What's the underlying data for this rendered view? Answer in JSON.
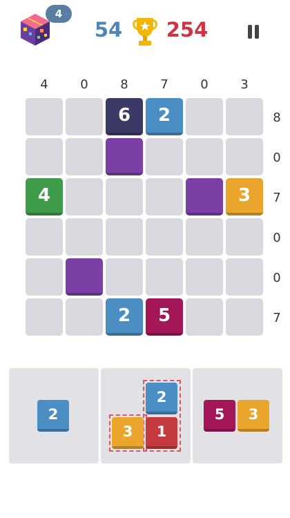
{
  "header": {
    "badge_count": "4",
    "score": "54",
    "best": "254",
    "icons": [
      "gift-box-icon",
      "trophy-icon",
      "pause-icon"
    ]
  },
  "board": {
    "column_sums": [
      "4",
      "0",
      "8",
      "7",
      "0",
      "3"
    ],
    "row_sums": [
      "8",
      "0",
      "7",
      "0",
      "0",
      "7"
    ],
    "tiles": [
      {
        "row": 0,
        "col": 2,
        "value": "6",
        "color": "#3b3a66"
      },
      {
        "row": 0,
        "col": 3,
        "value": "2",
        "color": "#4b8ec4"
      },
      {
        "row": 1,
        "col": 2,
        "value": "",
        "color": "#7c3fa6"
      },
      {
        "row": 2,
        "col": 0,
        "value": "4",
        "color": "#3f9c4b"
      },
      {
        "row": 2,
        "col": 4,
        "value": "",
        "color": "#7c3fa6"
      },
      {
        "row": 2,
        "col": 5,
        "value": "3",
        "color": "#e9a52c"
      },
      {
        "row": 4,
        "col": 1,
        "value": "",
        "color": "#7c3fa6"
      },
      {
        "row": 5,
        "col": 2,
        "value": "2",
        "color": "#4b8ec4"
      },
      {
        "row": 5,
        "col": 3,
        "value": "5",
        "color": "#a31759"
      }
    ]
  },
  "pieces": {
    "piece_1": [
      {
        "value": "2",
        "color": "#4b8ec4"
      }
    ],
    "piece_2": [
      {
        "value": "2",
        "color": "#4b8ec4"
      },
      {
        "value": "3",
        "color": "#e9a52c"
      },
      {
        "value": "1",
        "color": "#c43a3f"
      }
    ],
    "piece_3": [
      {
        "value": "5",
        "color": "#a31759"
      },
      {
        "value": "3",
        "color": "#e9a52c"
      }
    ]
  },
  "colors": {
    "empty_cell": "#d9d8df",
    "tray": "#e2e2e6",
    "score": "#4f86b3",
    "best": "#cf3444",
    "dashed_outline": "#d9575f"
  }
}
